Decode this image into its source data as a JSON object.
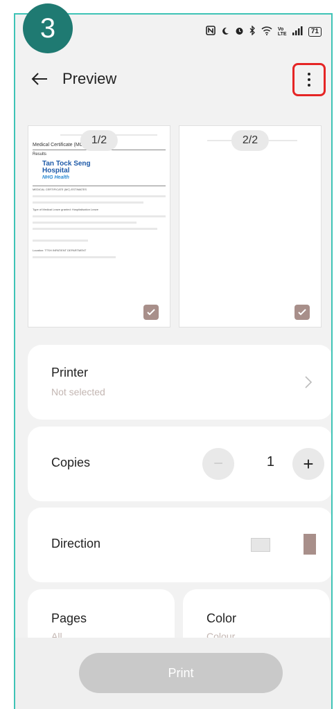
{
  "step_badge": "3",
  "status_bar": {
    "icons": [
      "nfc-icon",
      "moon-icon",
      "alarm-icon",
      "bluetooth-icon",
      "wifi-icon",
      "volte-icon",
      "signal-icon",
      "battery-icon"
    ],
    "volte": "Vo LTE",
    "battery": "71"
  },
  "header": {
    "title": "Preview"
  },
  "previews": [
    {
      "page_label": "1/2",
      "doc": {
        "heading": "Medical Certificate (MC)",
        "results": "Results",
        "hospital_line1": "Tan Tock Seng",
        "hospital_line2": "Hospital",
        "hospital_line3": "NHG Health",
        "section": "MEDICAL CERTIFICATE (MC) ESTIMATES",
        "type_line": "Type of Medical Leave granted: Hospitalisation Leave",
        "footer_line": "Location: TTSH INPATIENT DEPARTMENT"
      }
    },
    {
      "page_label": "2/2"
    }
  ],
  "printer": {
    "label": "Printer",
    "value": "Not selected"
  },
  "copies": {
    "label": "Copies",
    "count": "1",
    "minus": "−",
    "plus": "+"
  },
  "direction": {
    "label": "Direction"
  },
  "pages": {
    "label": "Pages",
    "value": "All"
  },
  "color": {
    "label": "Color",
    "value": "Colour"
  },
  "print_button": "Print",
  "colors": {
    "accent": "#a88f8a",
    "highlight": "#e52525",
    "badge": "#1f7a72"
  }
}
